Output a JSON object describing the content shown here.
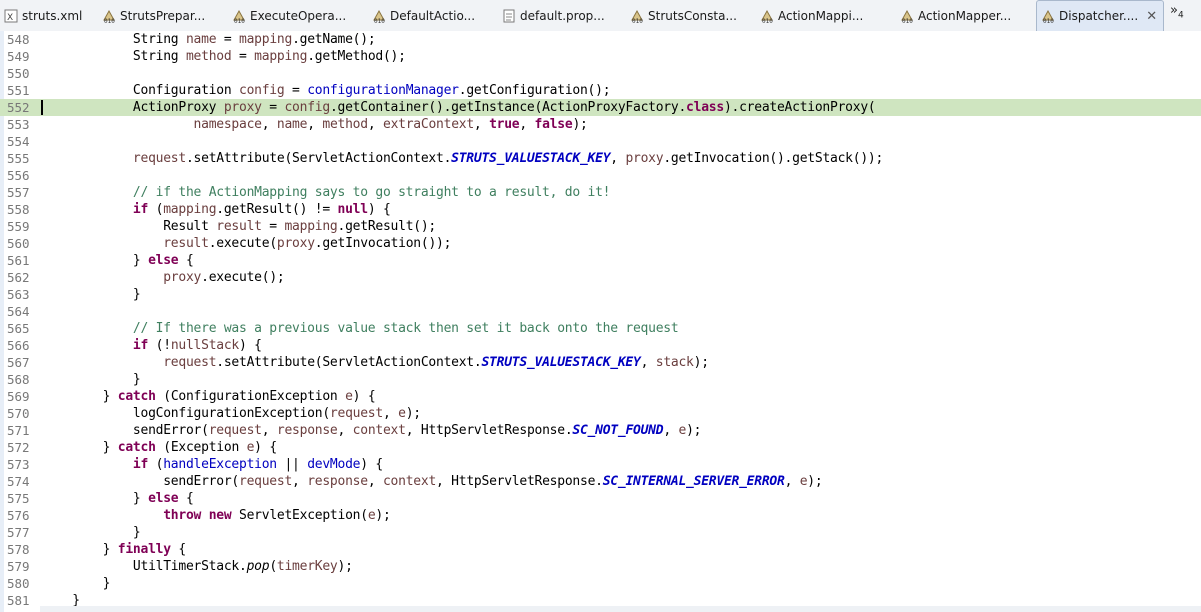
{
  "tabs": [
    {
      "label": "struts.xml",
      "icon": "xml-file-icon",
      "active": false
    },
    {
      "label": "StrutsPrepar...",
      "icon": "class-file-icon",
      "active": false
    },
    {
      "label": "ExecuteOpera...",
      "icon": "class-file-icon",
      "active": false
    },
    {
      "label": "DefaultActio...",
      "icon": "class-file-icon",
      "active": false
    },
    {
      "label": "default.prop...",
      "icon": "properties-file-icon",
      "active": false
    },
    {
      "label": "StrutsConsta...",
      "icon": "class-file-icon",
      "active": false
    },
    {
      "label": "ActionMappi...",
      "icon": "class-file-icon",
      "active": false
    },
    {
      "label": "ActionMapper...",
      "icon": "class-file-icon",
      "active": false
    },
    {
      "label": "Dispatcher....",
      "icon": "class-file-icon",
      "active": true,
      "close": "✕"
    }
  ],
  "overflow": {
    "symbol": "»",
    "count": "4"
  },
  "colors": {
    "keyword": "#7f0055",
    "field": "#0000c0",
    "comment": "#3f7f5f",
    "highlight": "#cfe5c0"
  },
  "editor": {
    "highlighted_line": "552",
    "lines": [
      {
        "n": "548",
        "t": [
          [
            "",
            "            String "
          ],
          [
            "loc",
            "name"
          ],
          [
            "",
            " = "
          ],
          [
            "loc",
            "mapping"
          ],
          [
            "",
            ".getName();"
          ]
        ]
      },
      {
        "n": "549",
        "t": [
          [
            "",
            "            String "
          ],
          [
            "loc",
            "method"
          ],
          [
            "",
            " = "
          ],
          [
            "loc",
            "mapping"
          ],
          [
            "",
            ".getMethod();"
          ]
        ]
      },
      {
        "n": "550",
        "t": []
      },
      {
        "n": "551",
        "t": [
          [
            "",
            "            Configuration "
          ],
          [
            "loc",
            "config"
          ],
          [
            "",
            " = "
          ],
          [
            "fld",
            "configurationManager"
          ],
          [
            "",
            ".getConfiguration();"
          ]
        ]
      },
      {
        "n": "552",
        "t": [
          [
            "",
            "            ActionProxy "
          ],
          [
            "loc",
            "proxy"
          ],
          [
            "",
            " = "
          ],
          [
            "loc",
            "config"
          ],
          [
            "",
            ".getContainer().getInstance(ActionProxyFactory."
          ],
          [
            "kw",
            "class"
          ],
          [
            "",
            ").createActionProxy("
          ]
        ]
      },
      {
        "n": "553",
        "t": [
          [
            "",
            "                    "
          ],
          [
            "loc",
            "namespace"
          ],
          [
            "",
            ", "
          ],
          [
            "loc",
            "name"
          ],
          [
            "",
            ", "
          ],
          [
            "loc",
            "method"
          ],
          [
            "",
            ", "
          ],
          [
            "loc",
            "extraContext"
          ],
          [
            "",
            ", "
          ],
          [
            "kw",
            "true"
          ],
          [
            "",
            ", "
          ],
          [
            "kw",
            "false"
          ],
          [
            "",
            ");"
          ]
        ]
      },
      {
        "n": "554",
        "t": []
      },
      {
        "n": "555",
        "t": [
          [
            "",
            "            "
          ],
          [
            "loc",
            "request"
          ],
          [
            "",
            ".setAttribute(ServletActionContext."
          ],
          [
            "sfld",
            "STRUTS_VALUESTACK_KEY"
          ],
          [
            "",
            ", "
          ],
          [
            "loc",
            "proxy"
          ],
          [
            "",
            ".getInvocation().getStack());"
          ]
        ]
      },
      {
        "n": "556",
        "t": []
      },
      {
        "n": "557",
        "t": [
          [
            "",
            "            "
          ],
          [
            "cm",
            "// if the ActionMapping says to go straight to a result, do it!"
          ]
        ]
      },
      {
        "n": "558",
        "t": [
          [
            "",
            "            "
          ],
          [
            "kw",
            "if"
          ],
          [
            "",
            " ("
          ],
          [
            "loc",
            "mapping"
          ],
          [
            "",
            ".getResult() != "
          ],
          [
            "kw",
            "null"
          ],
          [
            "",
            ") {"
          ]
        ]
      },
      {
        "n": "559",
        "t": [
          [
            "",
            "                Result "
          ],
          [
            "loc",
            "result"
          ],
          [
            "",
            " = "
          ],
          [
            "loc",
            "mapping"
          ],
          [
            "",
            ".getResult();"
          ]
        ]
      },
      {
        "n": "560",
        "t": [
          [
            "",
            "                "
          ],
          [
            "loc",
            "result"
          ],
          [
            "",
            ".execute("
          ],
          [
            "loc",
            "proxy"
          ],
          [
            "",
            ".getInvocation());"
          ]
        ]
      },
      {
        "n": "561",
        "t": [
          [
            "",
            "            } "
          ],
          [
            "kw",
            "else"
          ],
          [
            "",
            " {"
          ]
        ]
      },
      {
        "n": "562",
        "t": [
          [
            "",
            "                "
          ],
          [
            "loc",
            "proxy"
          ],
          [
            "",
            ".execute();"
          ]
        ]
      },
      {
        "n": "563",
        "t": [
          [
            "",
            "            }"
          ]
        ]
      },
      {
        "n": "564",
        "t": []
      },
      {
        "n": "565",
        "t": [
          [
            "",
            "            "
          ],
          [
            "cm",
            "// If there was a previous value stack then set it back onto the request"
          ]
        ]
      },
      {
        "n": "566",
        "t": [
          [
            "",
            "            "
          ],
          [
            "kw",
            "if"
          ],
          [
            "",
            " (!"
          ],
          [
            "loc",
            "nullStack"
          ],
          [
            "",
            ") {"
          ]
        ]
      },
      {
        "n": "567",
        "t": [
          [
            "",
            "                "
          ],
          [
            "loc",
            "request"
          ],
          [
            "",
            ".setAttribute(ServletActionContext."
          ],
          [
            "sfld",
            "STRUTS_VALUESTACK_KEY"
          ],
          [
            "",
            ", "
          ],
          [
            "loc",
            "stack"
          ],
          [
            "",
            ");"
          ]
        ]
      },
      {
        "n": "568",
        "t": [
          [
            "",
            "            }"
          ]
        ]
      },
      {
        "n": "569",
        "t": [
          [
            "",
            "        } "
          ],
          [
            "kw",
            "catch"
          ],
          [
            "",
            " (ConfigurationException "
          ],
          [
            "loc",
            "e"
          ],
          [
            "",
            ") {"
          ]
        ]
      },
      {
        "n": "570",
        "t": [
          [
            "",
            "            logConfigurationException("
          ],
          [
            "loc",
            "request"
          ],
          [
            "",
            ", "
          ],
          [
            "loc",
            "e"
          ],
          [
            "",
            ");"
          ]
        ]
      },
      {
        "n": "571",
        "t": [
          [
            "",
            "            sendError("
          ],
          [
            "loc",
            "request"
          ],
          [
            "",
            ", "
          ],
          [
            "loc",
            "response"
          ],
          [
            "",
            ", "
          ],
          [
            "loc",
            "context"
          ],
          [
            "",
            ", HttpServletResponse."
          ],
          [
            "sfld",
            "SC_NOT_FOUND"
          ],
          [
            "",
            ", "
          ],
          [
            "loc",
            "e"
          ],
          [
            "",
            ");"
          ]
        ]
      },
      {
        "n": "572",
        "t": [
          [
            "",
            "        } "
          ],
          [
            "kw",
            "catch"
          ],
          [
            "",
            " (Exception "
          ],
          [
            "loc",
            "e"
          ],
          [
            "",
            ") {"
          ]
        ]
      },
      {
        "n": "573",
        "t": [
          [
            "",
            "            "
          ],
          [
            "kw",
            "if"
          ],
          [
            "",
            " ("
          ],
          [
            "fld",
            "handleException"
          ],
          [
            "",
            " || "
          ],
          [
            "fld",
            "devMode"
          ],
          [
            "",
            ") {"
          ]
        ]
      },
      {
        "n": "574",
        "t": [
          [
            "",
            "                sendError("
          ],
          [
            "loc",
            "request"
          ],
          [
            "",
            ", "
          ],
          [
            "loc",
            "response"
          ],
          [
            "",
            ", "
          ],
          [
            "loc",
            "context"
          ],
          [
            "",
            ", HttpServletResponse."
          ],
          [
            "sfld",
            "SC_INTERNAL_SERVER_ERROR"
          ],
          [
            "",
            ", "
          ],
          [
            "loc",
            "e"
          ],
          [
            "",
            ");"
          ]
        ]
      },
      {
        "n": "575",
        "t": [
          [
            "",
            "            } "
          ],
          [
            "kw",
            "else"
          ],
          [
            "",
            " {"
          ]
        ]
      },
      {
        "n": "576",
        "t": [
          [
            "",
            "                "
          ],
          [
            "kw",
            "throw"
          ],
          [
            "",
            " "
          ],
          [
            "kw",
            "new"
          ],
          [
            "",
            " ServletException("
          ],
          [
            "loc",
            "e"
          ],
          [
            "",
            ");"
          ]
        ]
      },
      {
        "n": "577",
        "t": [
          [
            "",
            "            }"
          ]
        ]
      },
      {
        "n": "578",
        "t": [
          [
            "",
            "        } "
          ],
          [
            "kw",
            "finally"
          ],
          [
            "",
            " {"
          ]
        ]
      },
      {
        "n": "579",
        "t": [
          [
            "",
            "            UtilTimerStack."
          ],
          [
            "it",
            "pop"
          ],
          [
            "",
            "("
          ],
          [
            "loc",
            "timerKey"
          ],
          [
            "",
            ");"
          ]
        ]
      },
      {
        "n": "580",
        "t": [
          [
            "",
            "        }"
          ]
        ]
      },
      {
        "n": "581",
        "t": [
          [
            "",
            "    }"
          ]
        ]
      }
    ]
  }
}
